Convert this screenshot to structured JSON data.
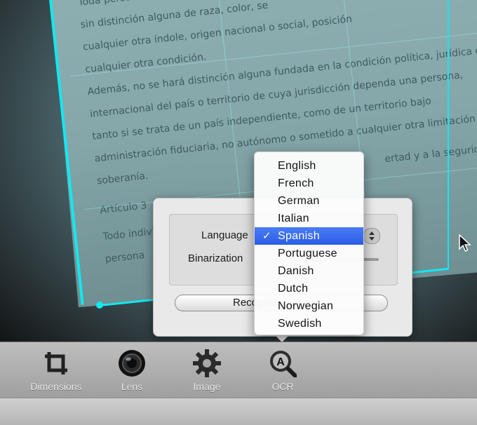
{
  "document": {
    "lines": [
      "Toda persona tiene los",
      "sin distinción alguna de raza, color, se",
      "cualquier otra índole, origen nacional o social, posición",
      "cualquier otra condición.",
      "Además, no se hará distinción alguna fundada en la condición política, jurídica o",
      "internacional del país o territorio de cuya jurisdicción dependa una persona,",
      "tanto si se trata de un país independiente, como de un territorio bajo",
      "administración fiduciaria, no autónomo o sometido a cualquier otra limitación de",
      "soberanía."
    ],
    "article": "Artículo 3",
    "after_article_lines": [
      "Todo individuo",
      "persona"
    ],
    "right_fragment": "ertad y a la seguridad de"
  },
  "panel": {
    "language_label": "Language",
    "binarization_label": "Binarization",
    "recognize_label": "Recognize"
  },
  "language_menu": {
    "checkmark": "✓",
    "items": [
      "English",
      "French",
      "German",
      "Italian",
      "Spanish",
      "Portuguese",
      "Danish",
      "Dutch",
      "Norwegian",
      "Swedish"
    ],
    "selected": "Spanish"
  },
  "toolbar": {
    "items": [
      {
        "label": "Dimensions",
        "icon": "crop-icon"
      },
      {
        "label": "Lens",
        "icon": "lens-icon"
      },
      {
        "label": "Image",
        "icon": "gear-icon"
      },
      {
        "label": "OCR",
        "icon": "ocr-magnifier-icon"
      }
    ]
  },
  "colors": {
    "crop_outline": "#12e8f0",
    "menu_highlight": "#2a5de8"
  }
}
